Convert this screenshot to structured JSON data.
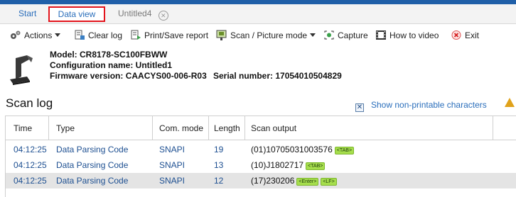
{
  "tabs": {
    "start": "Start",
    "data_view": "Data view",
    "untitled": "Untitled4",
    "close_icon": "close-circle-icon"
  },
  "toolbar": {
    "actions": "Actions",
    "clear_log": "Clear log",
    "print_save": "Print/Save report",
    "scan_mode": "Scan / Picture mode",
    "capture": "Capture",
    "how_to": "How to video",
    "exit": "Exit"
  },
  "device": {
    "model": "Model: CR8178-SC100FBWW",
    "config": "Configuration name: Untitled1",
    "firmware": "Firmware version: CAACYS00-006-R03",
    "serial": "Serial number: 17054010504829"
  },
  "scan_log": {
    "title": "Scan log",
    "show_nonprintable": "Show non-printable characters",
    "show_nonprintable_checked": true,
    "columns": [
      "Time",
      "Type",
      "Com. mode",
      "Length",
      "Scan output"
    ],
    "rows": [
      {
        "time": "04:12:25",
        "type": "Data Parsing Code",
        "mode": "SNAPI",
        "length": "19",
        "output": "(01)10705031003576",
        "tags": [
          "<TAB>"
        ]
      },
      {
        "time": "04:12:25",
        "type": "Data Parsing Code",
        "mode": "SNAPI",
        "length": "13",
        "output": "(10)J1802717",
        "tags": [
          "<TAB>"
        ]
      },
      {
        "time": "04:12:25",
        "type": "Data Parsing Code",
        "mode": "SNAPI",
        "length": "12",
        "output": "(17)230206",
        "tags": [
          "<Enter>",
          "<LF>"
        ]
      }
    ]
  },
  "colors": {
    "accent_blue": "#2a6ebb",
    "tab_highlight": "#e3141c",
    "tag_green": "#a6de4d",
    "warning": "#e0a21b"
  }
}
